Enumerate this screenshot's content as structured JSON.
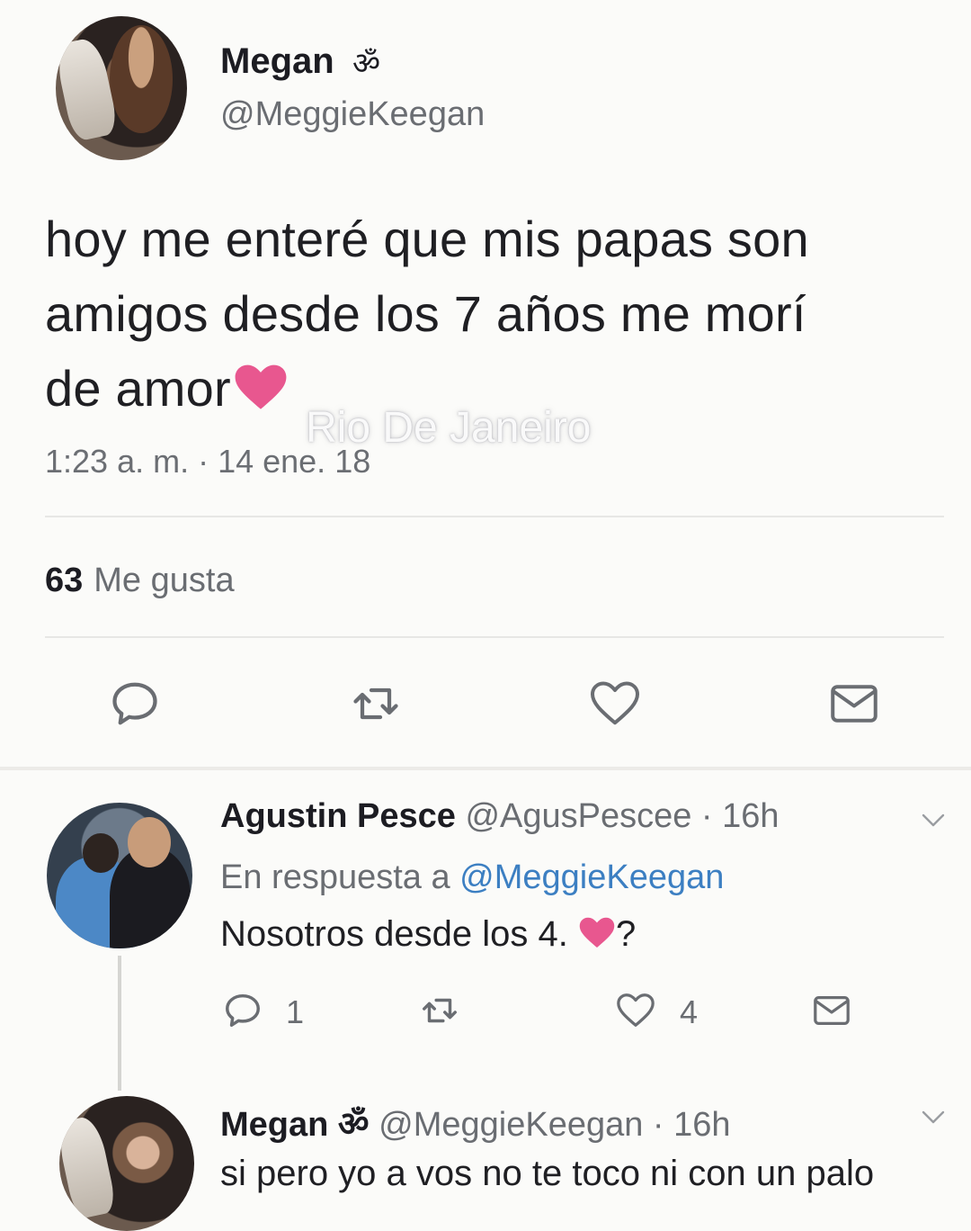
{
  "main_tweet": {
    "name": "Megan",
    "name_emoji": "ॐ",
    "handle": "@MeggieKeegan",
    "text_lines": [
      "hoy me enteré que mis papas son",
      "amigos desde los 7 años me morí",
      "de amor"
    ],
    "watermark": "Rio De Janeiro",
    "timestamp": "1:23 a. m. · 14 ene. 18",
    "likes_count": "63",
    "likes_label": "Me gusta"
  },
  "reply": {
    "name": "Agustin Pesce",
    "handle_time": "@AgusPescee · 16h",
    "reply_to_prefix": "En respuesta a",
    "reply_to_mention": "@MeggieKeegan",
    "text": "Nosotros desde los 4.",
    "text_suffix": "?",
    "reply_count": "1",
    "like_count": "4"
  },
  "nested_reply": {
    "name": "Megan",
    "name_emoji": "ॐ",
    "handle_time": "@MeggieKeegan · 16h",
    "text": "si pero yo a vos no te toco ni con un palo"
  },
  "colors": {
    "heart_pink": "#e8578f",
    "mention_blue": "#3c7fc2",
    "icon_gray": "#6a6d72"
  }
}
